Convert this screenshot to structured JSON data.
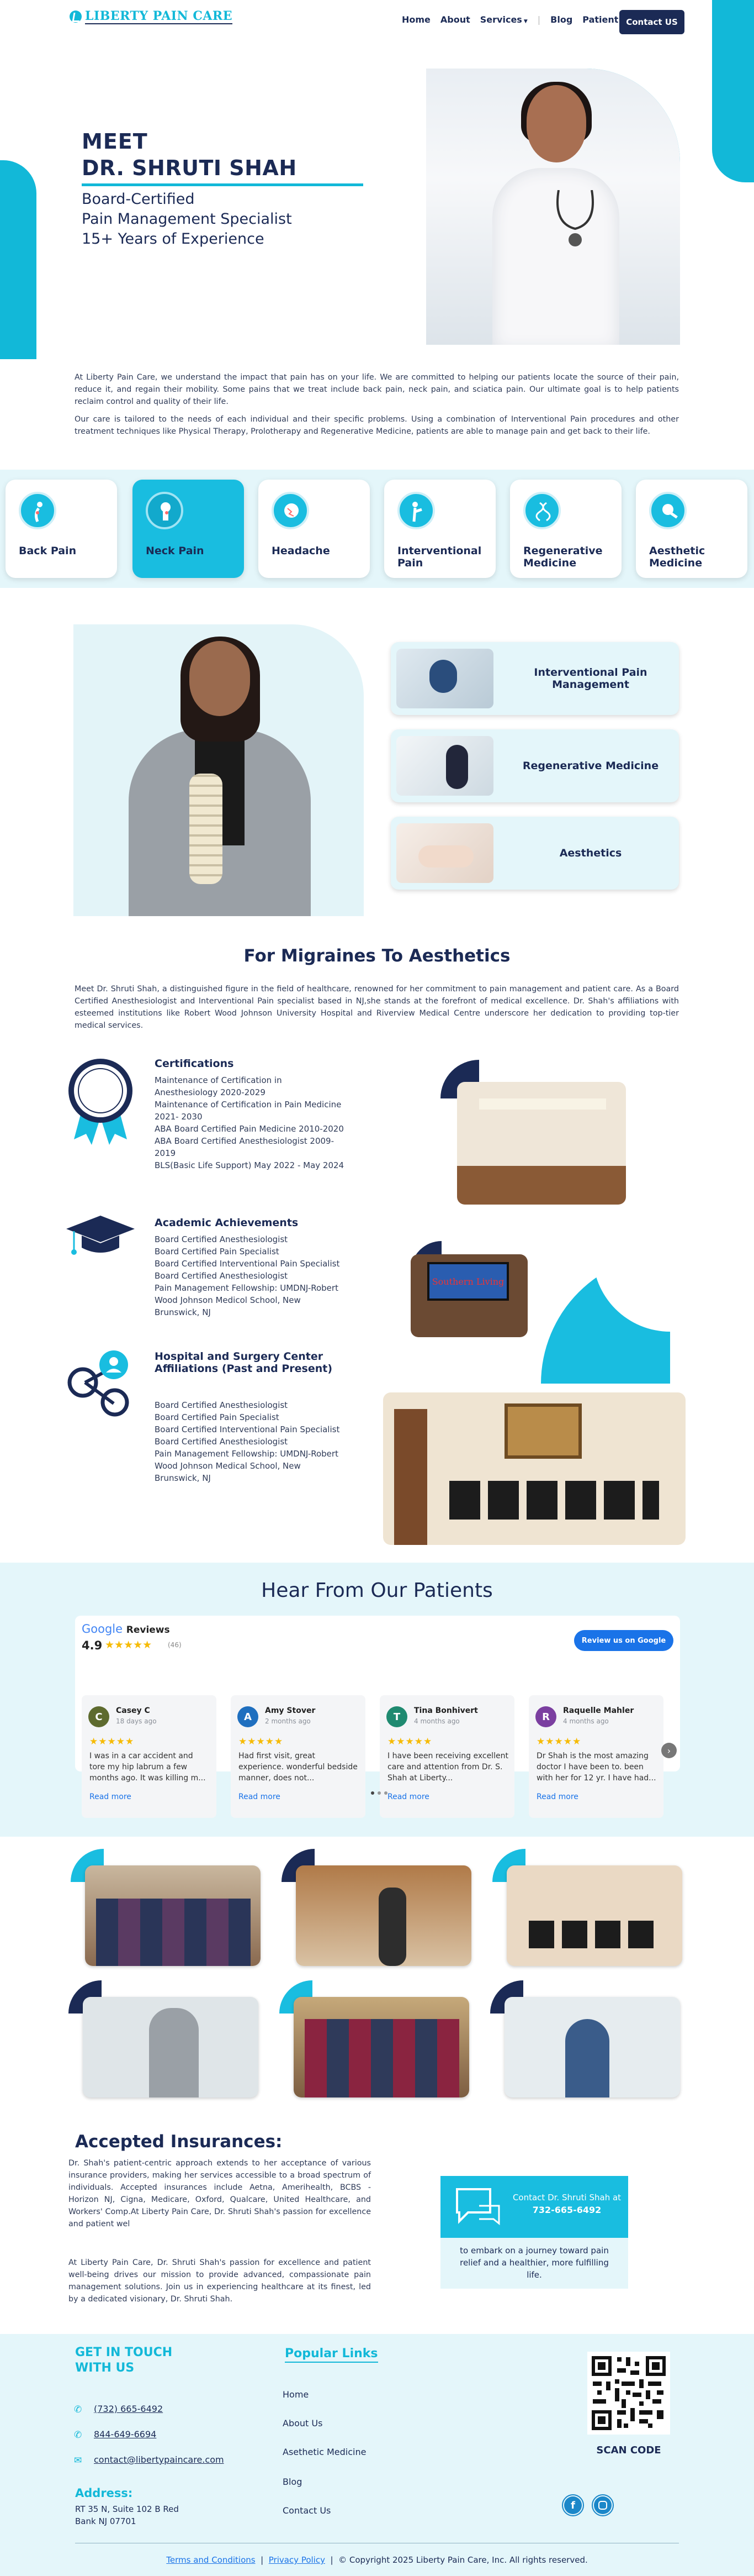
{
  "header": {
    "logo_text": "LIBERTY PAIN CARE",
    "nav": [
      "Home",
      "About",
      "Services",
      "Blog",
      "Patient"
    ],
    "cta": "Contact US",
    "colors": {
      "navy": "#1b2a55",
      "accent": "#12b8d8"
    }
  },
  "hero": {
    "meet": "MEET",
    "name": "DR. SHRUTI SHAH",
    "line1": "Board-Certified",
    "line2": "Pain Management Specialist",
    "line3": "15+ Years of Experience"
  },
  "intro": {
    "p1": "At Liberty Pain Care, we understand the impact that pain has on your life. We are committed to helping our patients locate the source of their pain, reduce it, and regain their mobility. Some pains that we treat include back pain, neck pain, and sciatica pain. Our ultimate goal is to help patients reclaim control and quality of their life.",
    "p2": "Our care is tailored to the needs of each individual and their specific problems. Using a combination of Interventional Pain procedures and other treatment techniques like Physical Therapy, Prolotherapy and Regenerative Medicine, patients are able to manage pain and get back to their life."
  },
  "services": [
    {
      "label": "Back Pain",
      "icon": "back-pain-icon",
      "active": false
    },
    {
      "label": "Neck Pain",
      "icon": "neck-pain-icon",
      "active": true
    },
    {
      "label": "Headache",
      "icon": "headache-icon",
      "active": false
    },
    {
      "label": "Interventional Pain",
      "icon": "interventional-pain-icon",
      "active": false
    },
    {
      "label": "Regenerative Medicine",
      "icon": "regenerative-medicine-icon",
      "active": false
    },
    {
      "label": "Aesthetic Medicine",
      "icon": "aesthetic-medicine-icon",
      "active": false
    }
  ],
  "featured": {
    "cards": [
      "Interventional Pain Management",
      "Regenerative Medicine",
      "Aesthetics"
    ]
  },
  "about": {
    "heading": "For Migraines To Aesthetics",
    "text": "Meet Dr. Shruti Shah, a distinguished figure in the field of healthcare, renowned for her commitment to pain management and patient care. As a Board Certified Anesthesiologist and Interventional Pain specialist based in NJ,she stands at the forefront of medical excellence. Dr. Shah's affiliations with esteemed institutions like Robert Wood Johnson University Hospital and Riverview Medical Centre underscore her dedication to providing top-tier medical services."
  },
  "credentials": [
    {
      "title": "Certifications",
      "icon": "medal-icon",
      "items": [
        "Maintenance of Certification in Anesthesiology 2020-2029",
        "Maintenance of Certification in Pain Medicine 2021- 2030",
        "ABA Board Certified Pain Medicine 2010-2020",
        "ABA Board Certified Anesthesiologist 2009-2019",
        "BLS(Basic Life Support) May 2022 - May 2024"
      ]
    },
    {
      "title": "Academic Achievements",
      "icon": "graduation-cap-icon",
      "items": [
        "Board Certified Anesthesiologist",
        "Board Certified Pain Specialist",
        "Board Certified Interventional Pain Specialist",
        "Board Certified Anesthesiologist",
        "Pain Management Fellowship: UMDNJ-Robert Wood Johnson Medicol School, New Brunswick, NJ"
      ]
    },
    {
      "title": "Hospital and Surgery Center Affiliations (Past and Present)",
      "icon": "network-icon",
      "items": [
        "Board Certified Anesthesiologist",
        "Board Certified Pain Specialist",
        "Board Certified Interventional Pain Specialist",
        "Board Certified Anesthesiologist",
        "Pain Management Fellowship: UMDNJ-Robert Wood Johnson Medical School, New Brunswick, NJ"
      ]
    }
  ],
  "office_tv_text": "Southern Living",
  "reviews": {
    "heading": "Hear From Our Patients",
    "brand": "Google",
    "brand_suffix": "Reviews",
    "rating": "4.9",
    "stars": "★★★★★",
    "count": "(46)",
    "cta": "Review us on Google",
    "read_more": "Read more",
    "items": [
      {
        "initial": "C",
        "name": "Casey C",
        "age": "18 days ago",
        "text": "I was in a car accident and tore my hip labrum a few months ago. It was killing m...",
        "color": "#5e6b2f"
      },
      {
        "initial": "A",
        "name": "Amy Stover",
        "age": "2 months ago",
        "text": "Had first visit, great experience. wonderful bedside manner, does not...",
        "color": "#1f6fbf"
      },
      {
        "initial": "T",
        "name": "Tina Bonhivert",
        "age": "4 months ago",
        "text": "I have been receiving excellent care and attention from Dr. S. Shah at Liberty...",
        "color": "#1f8a70"
      },
      {
        "initial": "R",
        "name": "Raquelle Mahler",
        "age": "4 months ago",
        "text": "Dr Shah is the most amazing doctor I have been to. been with her for 12 yr. I have had...",
        "color": "#7b3fa0"
      }
    ]
  },
  "insurance": {
    "heading": "Accepted Insurances:",
    "p1": "Dr. Shah's patient-centric approach extends to her acceptance of various insurance providers, making her services accessible to a broad spectrum of individuals. Accepted insurances include Aetna, Amerihealth, BCBS - Horizon NJ, Cigna, Medicare, Oxford, Qualcare, United Healthcare, and Workers' Comp.At Liberty Pain Care, Dr. Shruti Shah's passion for excellence and patient wel",
    "p2": "At Liberty Pain Care, Dr. Shruti Shah's passion for excellence and patient well-being drives our mission to provide advanced, compassionate pain management solutions. Join us in experiencing healthcare at its finest, led by a dedicated visionary, Dr. Shruti Shah.",
    "contact_title": "Contact Dr. Shruti Shah at",
    "contact_phone": "732-665-6492",
    "contact_tagline": "to embark on a journey toward pain relief and a healthier, more fulfilling life."
  },
  "footer": {
    "touch_heading": "GET IN TOUCH WITH US",
    "phone1": "(732) 665-6492",
    "phone2": "844-649-6694",
    "email": "contact@libertypaincare.com",
    "address_label": "Address:",
    "address1": "RT 35 N, Suite 102 B Red",
    "address2": "Bank NJ 07701",
    "links_heading": "Popular Links",
    "links": [
      "Home",
      "About Us",
      "Asethetic Medicine",
      "Blog",
      "Contact Us"
    ],
    "scan_label": "SCAN CODE",
    "terms": "Terms and Conditions",
    "sep": "|",
    "privacy": "Privacy Policy",
    "copyright": "© Copyright 2025 Liberty Pain Care, Inc. All rights reserved."
  }
}
